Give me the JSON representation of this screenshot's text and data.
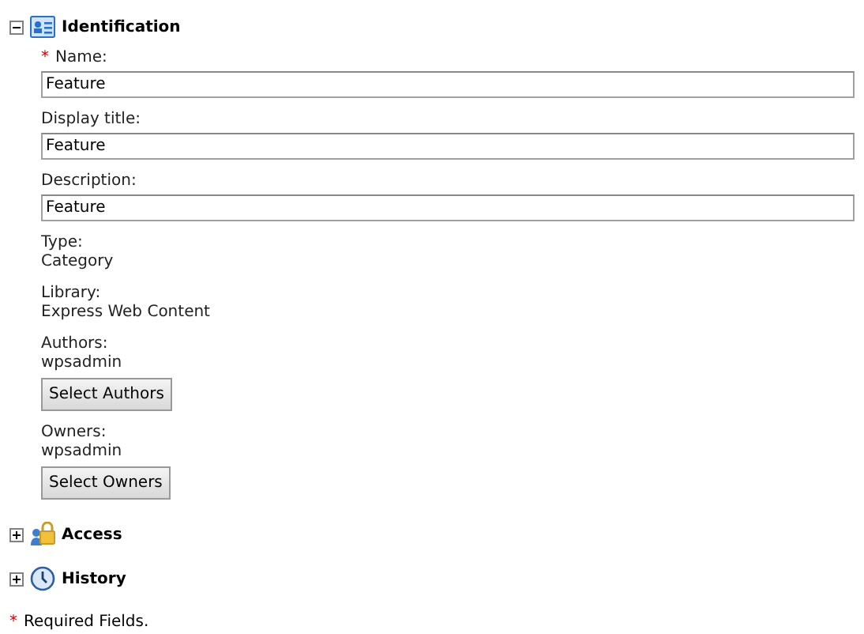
{
  "sections": [
    {
      "title": "Identification",
      "kind": "card",
      "expanded": true,
      "fields": [
        {
          "kind": "input",
          "marker": "*",
          "label": "Name:",
          "value": "Feature"
        },
        {
          "kind": "input",
          "label": "Display title:",
          "value": "Feature"
        },
        {
          "kind": "input",
          "label": "Description:",
          "value": "Feature"
        },
        {
          "kind": "text",
          "label": "Type:",
          "value": "Category"
        },
        {
          "kind": "text",
          "label": "Library:",
          "value": "Express Web Content"
        },
        {
          "kind": "picker",
          "label": "Authors:",
          "value": "wpsadmin",
          "button": "Select Authors"
        },
        {
          "kind": "picker",
          "label": "Owners:",
          "value": "wpsadmin",
          "button": "Select Owners"
        }
      ]
    },
    {
      "title": "Access",
      "kind": "lock",
      "expanded": false
    },
    {
      "title": "History",
      "kind": "clock",
      "expanded": false
    }
  ],
  "footnote": {
    "marker": "*",
    "text": "Required Fields."
  }
}
